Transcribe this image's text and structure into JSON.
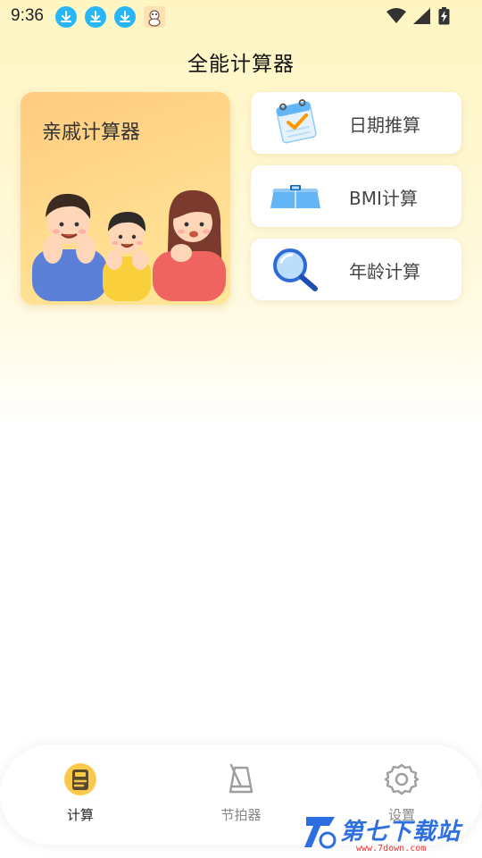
{
  "status_bar": {
    "time": "9:36",
    "icons_left": [
      "download-icon",
      "download-icon",
      "download-icon",
      "app-notification-icon"
    ],
    "icons_right": [
      "wifi-icon",
      "signal-icon",
      "battery-charging-icon"
    ]
  },
  "header": {
    "title": "全能计算器"
  },
  "main": {
    "family_card": {
      "label": "亲戚计算器",
      "illustration": "family-illustration"
    },
    "tools": [
      {
        "label": "日期推算",
        "icon": "calendar-icon"
      },
      {
        "label": "BMI计算",
        "icon": "scale-icon"
      },
      {
        "label": "年龄计算",
        "icon": "magnifier-icon"
      }
    ]
  },
  "bottom_nav": {
    "items": [
      {
        "label": "计算",
        "icon": "calculator-icon",
        "active": true
      },
      {
        "label": "节拍器",
        "icon": "metronome-icon",
        "active": false
      },
      {
        "label": "设置",
        "icon": "gear-icon",
        "active": false
      }
    ]
  },
  "watermark": {
    "text": "第七下载站",
    "url": "www.7down.com"
  },
  "colors": {
    "accent": "#f5b82e",
    "card_gradient_start": "#ffcc80",
    "card_gradient_end": "#ffe79a",
    "status_download": "#29b6f6",
    "background_top": "#fff6c4"
  }
}
